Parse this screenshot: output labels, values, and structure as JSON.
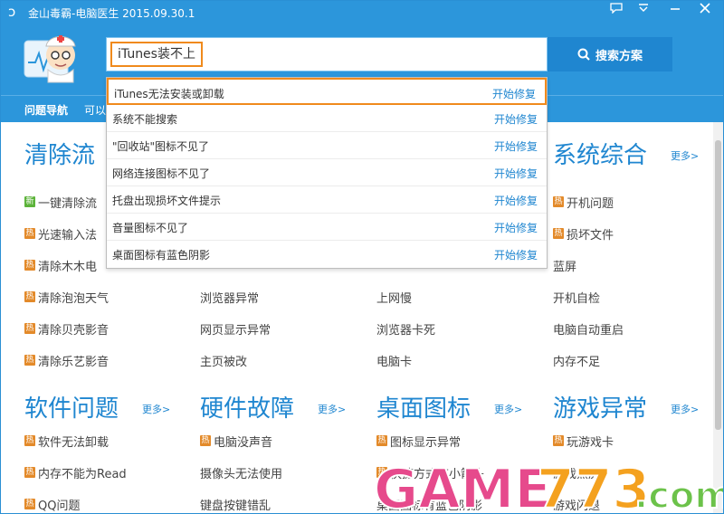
{
  "window": {
    "title": "金山毒霸-电脑医生",
    "version": "2015.09.30.1",
    "icons": [
      "feedback-icon",
      "menu-icon",
      "minimize-icon",
      "close-icon"
    ]
  },
  "search": {
    "value": "iTunes装不上",
    "button_label": "搜索方案"
  },
  "nav": {
    "items": [
      "问题导航",
      "可以"
    ]
  },
  "dropdown": {
    "rows": [
      {
        "text": "iTunes无法安装或卸载",
        "action": "开始修复"
      },
      {
        "text": "系统不能搜索",
        "action": "开始修复"
      },
      {
        "text": "\"回收站\"图标不见了",
        "action": "开始修复"
      },
      {
        "text": "网络连接图标不见了",
        "action": "开始修复"
      },
      {
        "text": "托盘出现损坏文件提示",
        "action": "开始修复"
      },
      {
        "text": "音量图标不见了",
        "action": "开始修复"
      },
      {
        "text": "桌面图标有蓝色阴影",
        "action": "开始修复"
      }
    ]
  },
  "sections": {
    "clean": {
      "title": "清除流",
      "items": [
        {
          "badge": "新",
          "text": "一键清除流"
        },
        {
          "badge": "热",
          "text": "光速输入法"
        },
        {
          "badge": "热",
          "text": "清除木木电"
        },
        {
          "badge": "热",
          "text": "清除泡泡天气"
        },
        {
          "badge": "热",
          "text": "清除贝壳影音"
        },
        {
          "badge": "热",
          "text": "清除乐艺影音"
        }
      ]
    },
    "col2": {
      "items": [
        {
          "badge": "",
          "text": "浏览器异常"
        },
        {
          "badge": "",
          "text": "网页显示异常"
        },
        {
          "badge": "",
          "text": "主页被改"
        }
      ]
    },
    "col3": {
      "items": [
        {
          "badge": "",
          "text": "上网慢"
        },
        {
          "badge": "",
          "text": "浏览器卡死"
        },
        {
          "badge": "",
          "text": "电脑卡"
        }
      ]
    },
    "system": {
      "title": "系统综合",
      "more": "更多>",
      "items": [
        {
          "badge": "热",
          "text": "开机问题"
        },
        {
          "badge": "热",
          "text": "损坏文件"
        },
        {
          "badge": "",
          "text": "蓝屏"
        },
        {
          "badge": "",
          "text": "开机自检"
        },
        {
          "badge": "",
          "text": "电脑自动重启"
        },
        {
          "badge": "",
          "text": "内存不足"
        }
      ]
    },
    "software": {
      "title": "软件问题",
      "more": "更多>",
      "items": [
        {
          "badge": "热",
          "text": "软件无法卸载"
        },
        {
          "badge": "热",
          "text": "内存不能为Read"
        },
        {
          "badge": "热",
          "text": "QQ问题"
        }
      ]
    },
    "hardware": {
      "title": "硬件故障",
      "more": "更多>",
      "items": [
        {
          "badge": "热",
          "text": "电脑没声音"
        },
        {
          "badge": "",
          "text": "摄像头无法使用"
        },
        {
          "badge": "",
          "text": "键盘按键错乱"
        }
      ]
    },
    "desktop": {
      "title": "桌面图标",
      "more": "更多>",
      "items": [
        {
          "badge": "热",
          "text": "图标显示异常"
        },
        {
          "badge": "热",
          "text": "快捷方式有小箭头"
        },
        {
          "badge": "",
          "text": "桌面图标有蓝色阴影"
        }
      ]
    },
    "game": {
      "title": "游戏异常",
      "more": "更多>",
      "items": [
        {
          "badge": "热",
          "text": "玩游戏卡"
        },
        {
          "badge": "",
          "text": "游戏黑屏"
        },
        {
          "badge": "",
          "text": "游戏闪退"
        }
      ]
    }
  },
  "watermark": {
    "text_a": "GAME",
    "text_b": "773",
    "text_c": ".com"
  },
  "colors": {
    "brand_blue": "#2c96db",
    "accent_orange": "#f08a1c",
    "link_blue": "#1f86d0"
  }
}
